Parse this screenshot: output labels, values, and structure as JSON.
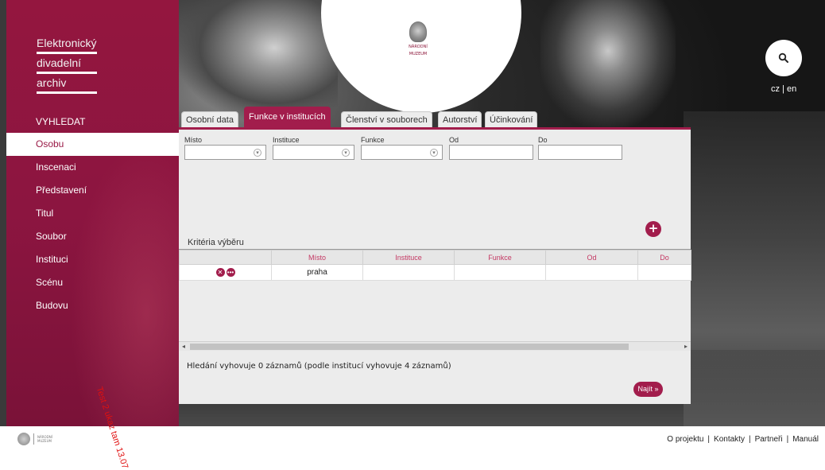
{
  "logo": {
    "lines": [
      "Elektronický",
      "divadelní",
      "archiv"
    ]
  },
  "museum_logo": {
    "name_line1": "NÁRODNÍ",
    "name_line2": "MUZEUM"
  },
  "language": {
    "cz": "cz",
    "separator": "|",
    "en": "en"
  },
  "search": {
    "icon": "search-icon"
  },
  "menu": {
    "heading": "VYHLEDAT",
    "items": [
      "Osobu",
      "Inscenaci",
      "Představení",
      "Titul",
      "Soubor",
      "Instituci",
      "Scénu",
      "Budovu"
    ],
    "active_index": 0
  },
  "stamp_text": "Test 2 ukaz tam 13.07",
  "tabs": [
    "Osobní data",
    "Funkce v institucích",
    "Členství v souborech",
    "Autorství",
    "Účinkování"
  ],
  "active_tab": 1,
  "form": {
    "fields": [
      {
        "label": "Místo",
        "type": "select",
        "value": ""
      },
      {
        "label": "Instituce",
        "type": "select",
        "value": ""
      },
      {
        "label": "Funkce",
        "type": "select",
        "value": ""
      },
      {
        "label": "Od",
        "type": "text",
        "value": ""
      },
      {
        "label": "Do",
        "type": "text",
        "value": ""
      }
    ],
    "add_button": "+"
  },
  "criteria": {
    "title": "Kritéria výběru",
    "columns": [
      "",
      "Místo",
      "Instituce",
      "Funkce",
      "Od",
      "Do"
    ],
    "rows": [
      [
        "",
        "praha",
        "",
        "",
        "",
        ""
      ]
    ]
  },
  "result_text": "Hledání vyhovuje 0 záznamů (podle institucí vyhovuje 4 záznamů)",
  "find_button": "Najít »",
  "footer": {
    "logo_line1": "NÁRODNÍ",
    "logo_line2": "MUZEUM",
    "links": [
      "O projektu",
      "Kontakty",
      "Partneři",
      "Manuál"
    ],
    "separator": "|"
  },
  "colors": {
    "brand": "#a21d4c",
    "sidebar": "#8c1540",
    "header_text": "#c43863"
  }
}
